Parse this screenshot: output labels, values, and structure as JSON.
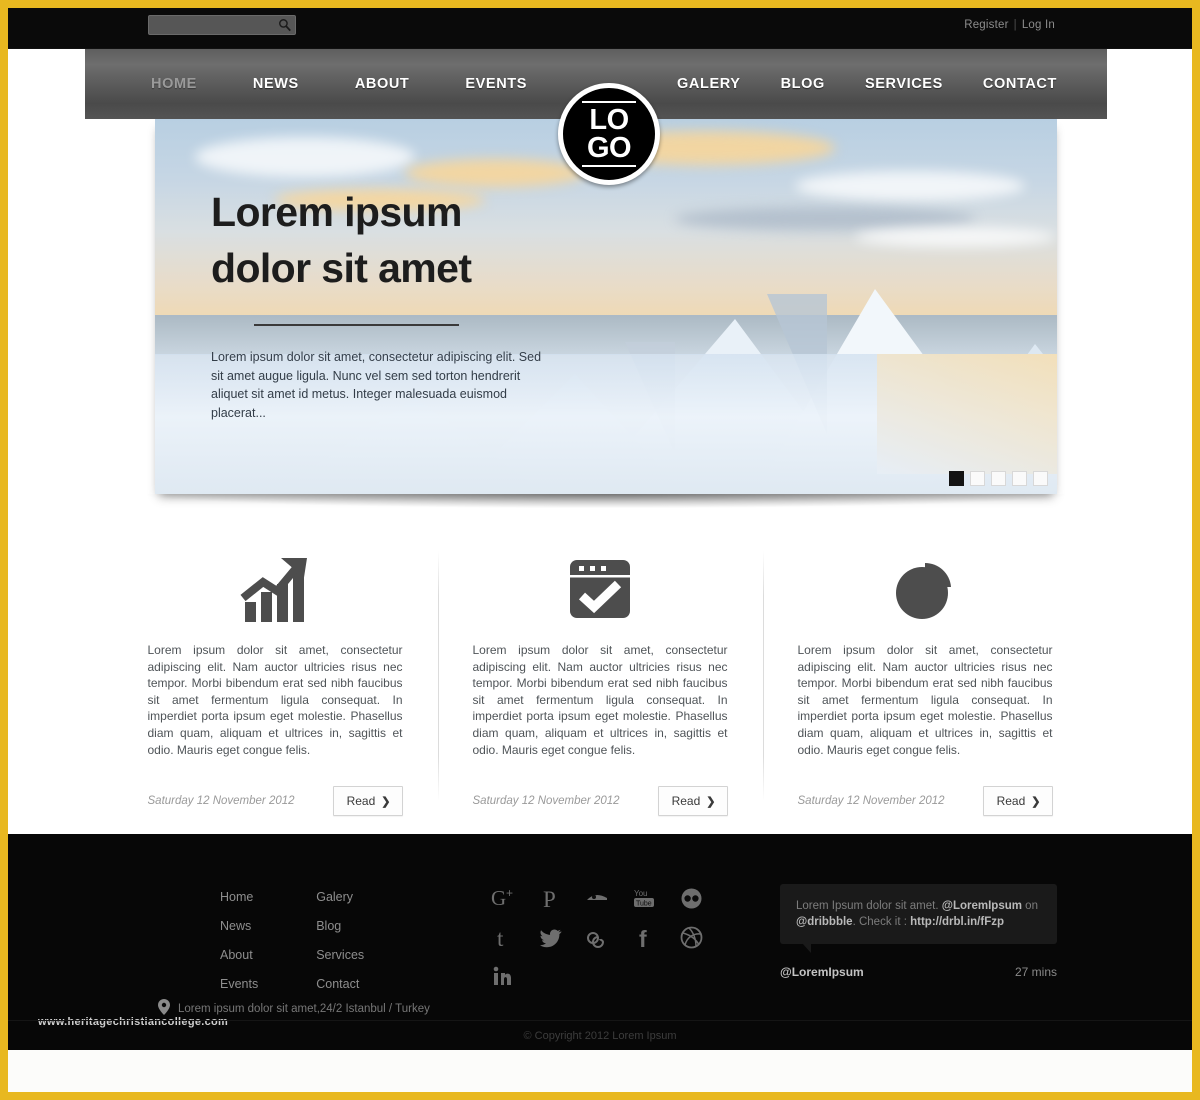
{
  "theme": {
    "frame_color": "#e8b820",
    "topbar_bg": "#0a0a0a",
    "nav_gradient_top": "#6e6e6e",
    "nav_gradient_bottom": "#4a4a4a",
    "footer_bg": "#070707",
    "page_bg": "#fcfcfa",
    "icon_gray": "#4d4d4d"
  },
  "topbar": {
    "search": {
      "value": "",
      "placeholder": "",
      "icon": "search-icon"
    },
    "register_label": "Register",
    "separator": "|",
    "login_label": "Log In"
  },
  "logo": {
    "line1": "LO",
    "line2": "GO"
  },
  "nav": {
    "left": [
      {
        "label": "HOME",
        "active": false,
        "state": "inactive"
      },
      {
        "label": "NEWS",
        "active": true,
        "state": "normal"
      },
      {
        "label": "ABOUT",
        "active": true,
        "state": "normal"
      },
      {
        "label": "EVENTS",
        "active": true,
        "state": "normal"
      }
    ],
    "right": [
      {
        "label": "GALERY",
        "active": true,
        "state": "normal"
      },
      {
        "label": "BLOG",
        "active": true,
        "state": "normal"
      },
      {
        "label": "SERVICES",
        "active": true,
        "state": "normal"
      },
      {
        "label": "CONTACT",
        "active": true,
        "state": "normal"
      }
    ]
  },
  "hero": {
    "title_line1": "Lorem ipsum",
    "title_line2": "dolor sit amet",
    "body": "Lorem ipsum dolor sit amet, consectetur adipiscing elit. Sed sit amet augue ligula. Nunc vel sem sed torton hendrerit aliquet sit amet id metus. Integer malesuada euismod placerat...",
    "slides": [
      {
        "index": 1,
        "active": true
      },
      {
        "index": 2,
        "active": false
      },
      {
        "index": 3,
        "active": false
      },
      {
        "index": 4,
        "active": false
      },
      {
        "index": 5,
        "active": false
      }
    ]
  },
  "features": [
    {
      "icon": "bar-chart-growth-icon",
      "text": "Lorem ipsum dolor sit amet, consectetur adipiscing elit. Nam auctor ultricies risus nec tempor. Morbi bibendum erat sed nibh faucibus sit amet fermentum ligula consequat. In imperdiet porta ipsum eget molestie. Phasellus diam quam, aliquam et ultrices in, sagittis et odio. Mauris eget congue felis.",
      "date": "Saturday 12 November 2012",
      "button_label": "Read",
      "button_chevron": "❯"
    },
    {
      "icon": "browser-checkmark-icon",
      "text": "Lorem ipsum dolor sit amet, consectetur adipiscing elit. Nam auctor ultricies risus nec tempor. Morbi bibendum erat sed nibh faucibus sit amet fermentum ligula consequat. In imperdiet porta ipsum eget molestie. Phasellus diam quam, aliquam et ultrices in, sagittis et odio. Mauris eget congue felis.",
      "date": "Saturday 12 November 2012",
      "button_label": "Read",
      "button_chevron": "❯"
    },
    {
      "icon": "pie-chart-icon",
      "text": "Lorem ipsum dolor sit amet, consectetur adipiscing elit. Nam auctor ultricies risus nec tempor. Morbi bibendum erat sed nibh faucibus sit amet fermentum ligula consequat. In imperdiet porta ipsum eget molestie. Phasellus diam quam, aliquam et ultrices in, sagittis et odio. Mauris eget congue felis.",
      "date": "Saturday 12 November 2012",
      "button_label": "Read",
      "button_chevron": "❯"
    }
  ],
  "footer": {
    "nav_col1": [
      "Home",
      "News",
      "About",
      "Events"
    ],
    "nav_col2": [
      "Galery",
      "Blog",
      "Services",
      "Contact"
    ],
    "socials": [
      "google-plus-icon",
      "pinterest-icon",
      "behance-icon",
      "youtube-icon",
      "flickr-icon",
      "tumblr-icon",
      "twitter-icon",
      "lastfm-icon",
      "facebook-icon",
      "dribbble-icon",
      "linkedin-icon"
    ],
    "tweet": {
      "text_1": "Lorem Ipsum dolor sit amet.",
      "handle_1": "@LoremIpsum",
      "text_2": "on",
      "handle_2": "@dribbble",
      "text_3": ". Check it :",
      "link": "http://drbl.in/fFzp",
      "author": "@LoremIpsum",
      "time": "27 mins"
    },
    "address": "Lorem ipsum dolor sit amet,24/2  Istanbul / Turkey",
    "address_icon": "map-pin-icon",
    "watermark": "www.heritagechristiancollege.com",
    "copyright": "© Copyright 2012 Lorem Ipsum"
  }
}
